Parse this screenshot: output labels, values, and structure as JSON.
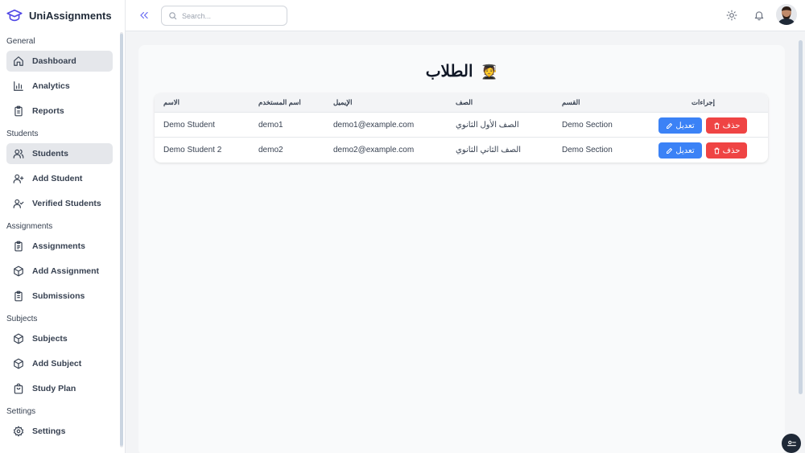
{
  "app": {
    "name": "UniAssignments"
  },
  "header": {
    "search_placeholder": "Search..."
  },
  "sidebar": {
    "sections": [
      {
        "title": "General",
        "items": [
          {
            "label": "Dashboard",
            "icon": "home-icon",
            "active": true
          },
          {
            "label": "Analytics",
            "icon": "bar-chart-icon"
          },
          {
            "label": "Reports",
            "icon": "clipboard-icon"
          }
        ]
      },
      {
        "title": "Students",
        "items": [
          {
            "label": "Students",
            "icon": "users-icon",
            "active": true
          },
          {
            "label": "Add Student",
            "icon": "user-plus-icon"
          },
          {
            "label": "Verified Students",
            "icon": "user-check-icon"
          }
        ]
      },
      {
        "title": "Assignments",
        "items": [
          {
            "label": "Assignments",
            "icon": "clipboard-list-icon"
          },
          {
            "label": "Add Assignment",
            "icon": "box-plus-icon"
          },
          {
            "label": "Submissions",
            "icon": "clipboard-check-icon"
          }
        ]
      },
      {
        "title": "Subjects",
        "items": [
          {
            "label": "Subjects",
            "icon": "box-icon"
          },
          {
            "label": "Add Subject",
            "icon": "box-plus-icon"
          },
          {
            "label": "Study Plan",
            "icon": "shopping-bag-icon"
          }
        ]
      },
      {
        "title": "Settings",
        "items": [
          {
            "label": "Settings",
            "icon": "gear-icon"
          }
        ]
      }
    ]
  },
  "main": {
    "title": "الطلاب",
    "title_emoji": "🧑‍🎓",
    "table": {
      "headers": {
        "name": "الاسم",
        "username": "اسم المستخدم",
        "email": "الإيميل",
        "class": "الصف",
        "section": "القسم",
        "actions": "إجراءات"
      },
      "rows": [
        {
          "name": "Demo Student",
          "username": "demo1",
          "email": "demo1@example.com",
          "class": "الصف الأول الثانوي",
          "section": "Demo Section",
          "edit": "تعديل",
          "delete": "حذف"
        },
        {
          "name": "Demo Student 2",
          "username": "demo2",
          "email": "demo2@example.com",
          "class": "الصف الثاني الثانوي",
          "section": "Demo Section",
          "edit": "تعديل",
          "delete": "حذف"
        }
      ]
    }
  },
  "colors": {
    "primary": "#3b82f6",
    "danger": "#ef4444",
    "accent": "#6366f1"
  }
}
